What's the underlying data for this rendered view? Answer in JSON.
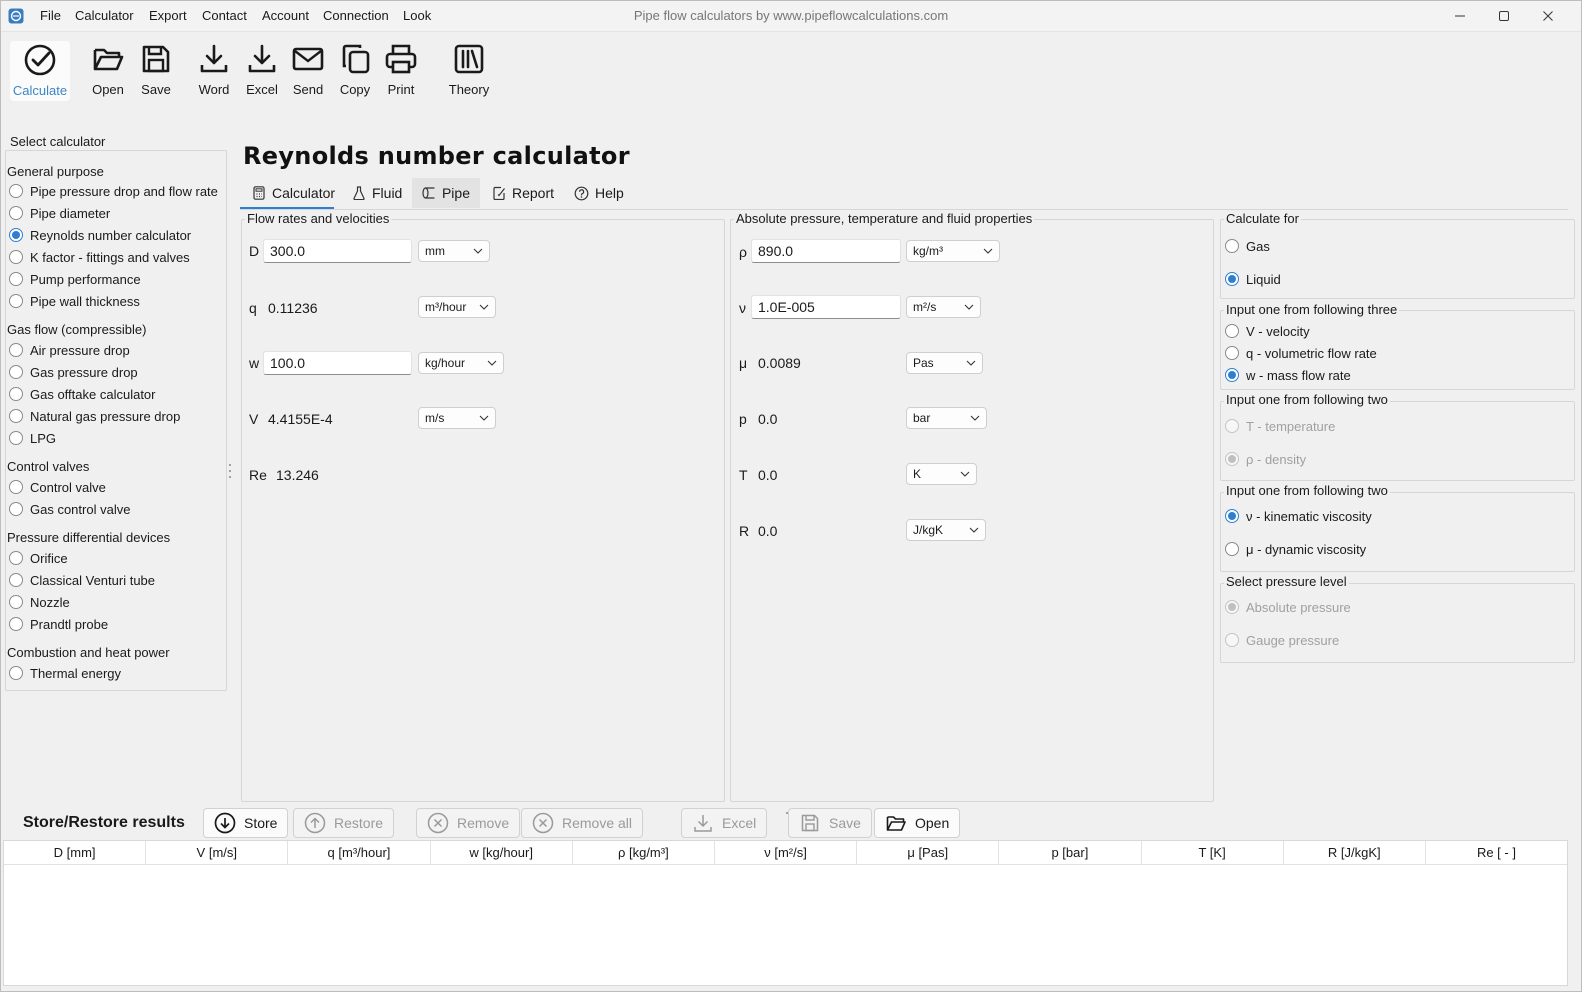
{
  "window": {
    "title": "Pipe flow calculators by www.pipeflowcalculations.com",
    "menu": [
      "File",
      "Calculator",
      "Export",
      "Contact",
      "Account",
      "Connection",
      "Look"
    ]
  },
  "toolbar": {
    "calculate": "Calculate",
    "open": "Open",
    "save": "Save",
    "word": "Word",
    "excel": "Excel",
    "send": "Send",
    "copy": "Copy",
    "print": "Print",
    "theory": "Theory",
    "accent_color": "#3a86c8"
  },
  "sidebar": {
    "title": "Select calculator",
    "groups": [
      {
        "title": "General purpose",
        "items": [
          "Pipe pressure drop and flow rate",
          "Pipe diameter",
          "Reynolds number calculator",
          "K factor - fittings and valves",
          "Pump performance",
          "Pipe wall thickness"
        ]
      },
      {
        "title": "Gas flow (compressible)",
        "items": [
          "Air pressure drop",
          "Gas pressure drop",
          "Gas offtake calculator",
          "Natural gas pressure drop",
          "LPG"
        ]
      },
      {
        "title": "Control valves",
        "items": [
          "Control valve",
          "Gas control valve"
        ]
      },
      {
        "title": "Pressure differential devices",
        "items": [
          "Orifice",
          "Classical Venturi tube",
          "Nozzle",
          "Prandtl probe"
        ]
      },
      {
        "title": "Combustion and heat power",
        "items": [
          "Thermal energy"
        ]
      }
    ],
    "selected": "Reynolds number calculator"
  },
  "main": {
    "title": "Reynolds number calculator",
    "tabs": [
      "Calculator",
      "Fluid",
      "Pipe",
      "Report",
      "Help"
    ],
    "active_tab": "Calculator",
    "flow": {
      "title": "Flow rates and velocities",
      "D": {
        "label": "D",
        "value": "300.0",
        "unit": "mm"
      },
      "q": {
        "label": "q",
        "value": "0.11236",
        "unit": "m³/hour"
      },
      "w": {
        "label": "w",
        "value": "100.0",
        "unit": "kg/hour"
      },
      "V": {
        "label": "V",
        "value": "4.4155E-4",
        "unit": "m/s"
      },
      "Re": {
        "label": "Re",
        "value": "13.246"
      }
    },
    "props": {
      "title": "Absolute pressure, temperature and fluid properties",
      "rho": {
        "label": "ρ",
        "value": "890.0",
        "unit": "kg/m³"
      },
      "nu": {
        "label": "ν",
        "value": "1.0E-005",
        "unit": "m²/s"
      },
      "mu": {
        "label": "μ",
        "value": "0.0089",
        "unit": "Pas"
      },
      "p": {
        "label": "p",
        "value": "0.0",
        "unit": "bar"
      },
      "T": {
        "label": "T",
        "value": "0.0",
        "unit": "K"
      },
      "R": {
        "label": "R",
        "value": "0.0",
        "unit": "J/kgK"
      }
    }
  },
  "options": {
    "calc_for": {
      "title": "Calculate for",
      "options": [
        "Gas",
        "Liquid"
      ],
      "selected": "Liquid"
    },
    "input3": {
      "title": "Input one from following three",
      "options": [
        "V - velocity",
        "q - volumetric flow rate",
        "w - mass flow rate"
      ],
      "selected": "w - mass flow rate"
    },
    "input2a": {
      "title": "Input one from following two",
      "options": [
        "T - temperature",
        "ρ - density"
      ],
      "selected": "ρ - density",
      "disabled": true
    },
    "input2b": {
      "title": "Input one from following two",
      "options": [
        "ν - kinematic viscosity",
        "μ - dynamic viscosity"
      ],
      "selected": "ν - kinematic viscosity"
    },
    "pressure": {
      "title": "Select pressure level",
      "options": [
        "Absolute pressure",
        "Gauge pressure"
      ],
      "selected": "Absolute pressure",
      "disabled": true
    }
  },
  "store": {
    "title": "Store/Restore results",
    "buttons": {
      "store": "Store",
      "restore": "Restore",
      "remove": "Remove",
      "remove_all": "Remove all",
      "excel": "Excel",
      "save": "Save",
      "open": "Open"
    },
    "columns": [
      "D [mm]",
      "V [m/s]",
      "q [m³/hour]",
      "w [kg/hour]",
      "ρ [kg/m³]",
      "ν [m²/s]",
      "μ [Pas]",
      "p [bar]",
      "T [K]",
      "R [J/kgK]",
      "Re [ - ]"
    ]
  }
}
